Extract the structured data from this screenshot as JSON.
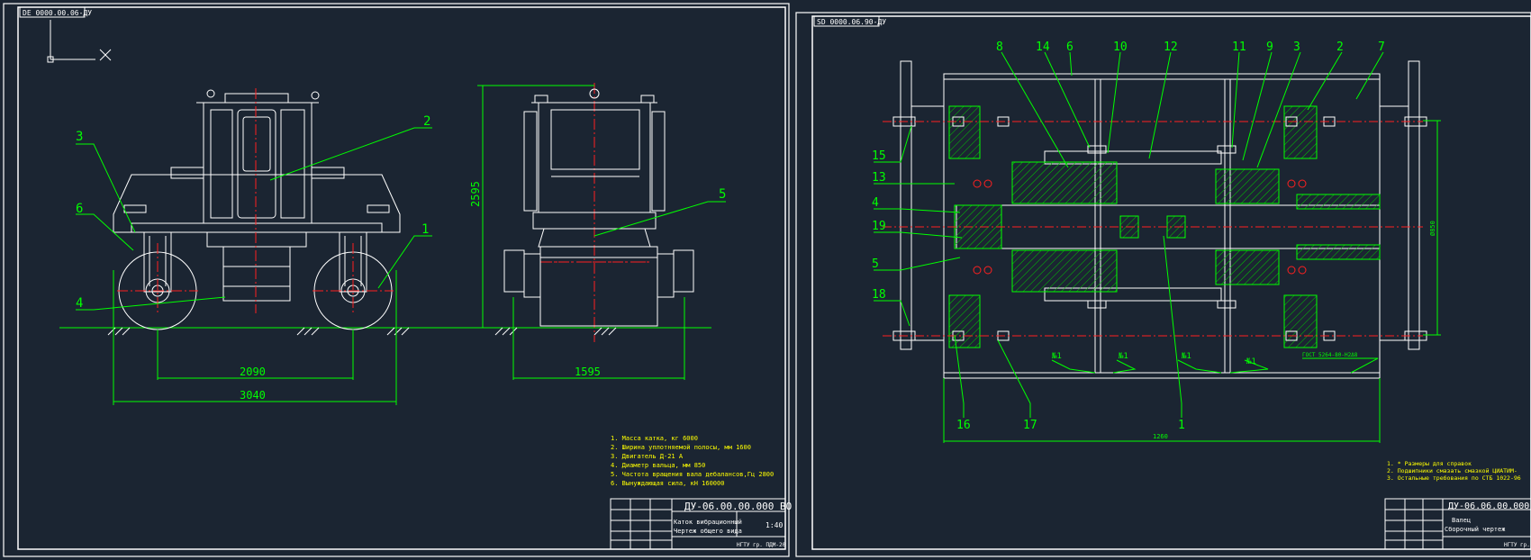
{
  "sheet_left": {
    "stamp": "DE 0000.00.06-ДУ",
    "leaders": [
      "1",
      "2",
      "3",
      "4",
      "5",
      "6"
    ],
    "dimensions": {
      "height": "2595",
      "wheelbase": "2090",
      "overall_length": "3040",
      "track": "1595"
    },
    "notes": [
      "1. Масса катка, кг 6000",
      "2. Ширина уплотняемой полосы, мм 1600",
      "3. Двигатель Д-21 А",
      "4. Диаметр вальца, мм 850",
      "5. Частота вращения вала дебалансов,Гц 2800",
      "6. Вынуждающая сила, кН 160000"
    ],
    "title_block": {
      "code": "ДУ-06.00.00.000 ВО",
      "name_line1": "Каток вибрационный",
      "name_line2": "Чертеж общего вида",
      "scale": "1:40",
      "org": "НГТУ гр. ПДМ-20"
    }
  },
  "sheet_right": {
    "stamp": "SD 0000.06.90-ДУ",
    "leaders": [
      "8",
      "14",
      "6",
      "10",
      "12",
      "11",
      "9",
      "3",
      "2",
      "7",
      "15",
      "13",
      "4",
      "19",
      "5",
      "18",
      "16",
      "17",
      "1"
    ],
    "weld_marks": [
      "№1",
      "№1",
      "№1",
      "№1"
    ],
    "gost": "ГОСТ 5264-80-Н2Δ8",
    "dimensions": {
      "length": "1260",
      "diameter": "Ø850"
    },
    "notes": [
      "1. * Размеры для справок",
      "2. Подшипники смазать смазкой ЦИАТИМ-",
      "3. Остальные требования по СТБ 1022-96"
    ],
    "title_block": {
      "code": "ДУ-06.06.00.000",
      "name_line1": "Валец",
      "name_line2": "Сборочный чертеж",
      "org": "НГТУ гр."
    }
  },
  "colors": {
    "background": "#1b2532",
    "frame": "#ffffff",
    "leader": "#00ff00",
    "center": "#ff2020",
    "dim": "#00ff00",
    "hatch": "#00cc00",
    "text": "#ffff00"
  }
}
